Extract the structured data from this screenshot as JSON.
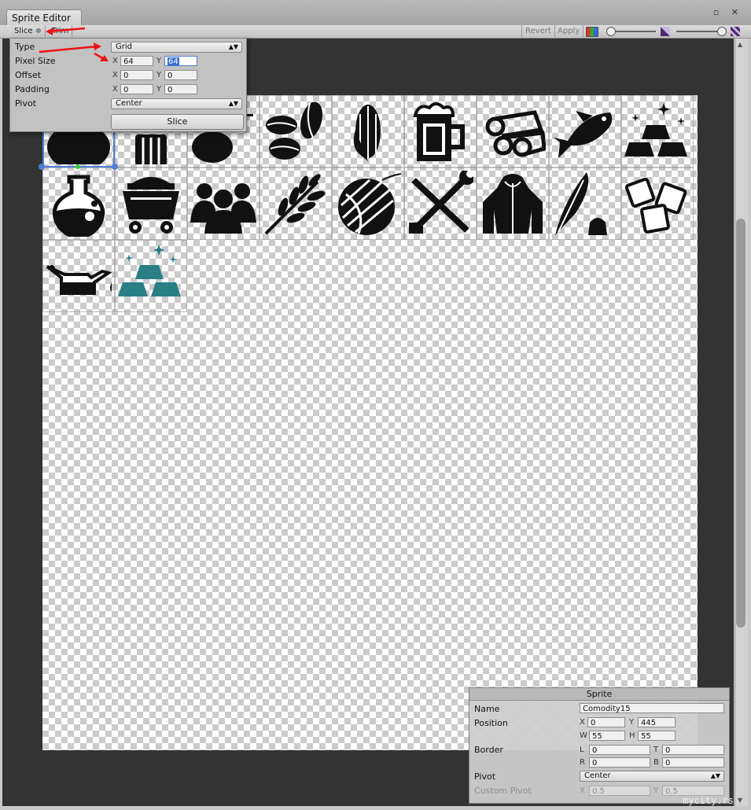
{
  "window": {
    "tab_title": "Sprite Editor",
    "controls": "▫ ✕"
  },
  "toolbar": {
    "slice_label": "Slice ≑",
    "trim_label": "Trim",
    "revert_label": "Revert",
    "apply_label": "Apply"
  },
  "slice_popup": {
    "type_label": "Type",
    "type_value": "Grid",
    "pixel_size_label": "Pixel Size",
    "pixel_x": "64",
    "pixel_y": "64",
    "offset_label": "Offset",
    "offset_x": "0",
    "offset_y": "0",
    "padding_label": "Padding",
    "padding_x": "0",
    "padding_y": "0",
    "pivot_label": "Pivot",
    "pivot_value": "Center",
    "slice_button": "Slice",
    "x_axis": "X",
    "y_axis": "Y"
  },
  "sprite_panel": {
    "title": "Sprite",
    "name_label": "Name",
    "name_value": "Comodity15",
    "position_label": "Position",
    "pos_x": "0",
    "pos_y": "445",
    "pos_w": "55",
    "pos_h": "55",
    "border_label": "Border",
    "border_l": "0",
    "border_t": "0",
    "border_r": "0",
    "border_b": "0",
    "pivot_label": "Pivot",
    "pivot_value": "Center",
    "custom_pivot_label": "Custom Pivot",
    "custom_x": "0.5",
    "custom_y": "0.5",
    "x_axis": "X",
    "y_axis": "Y",
    "w_axis": "W",
    "h_axis": "H",
    "l_axis": "L",
    "t_axis": "T",
    "r_axis": "R",
    "b_axis": "B"
  },
  "sprites": [
    {
      "icon": "oil-bottle-icon"
    },
    {
      "icon": "barrel-icon"
    },
    {
      "icon": "stone-icon"
    },
    {
      "icon": "coffee-beans-icon"
    },
    {
      "icon": "corn-icon"
    },
    {
      "icon": "beer-mug-icon"
    },
    {
      "icon": "logs-icon"
    },
    {
      "icon": "fish-icon"
    },
    {
      "icon": "gold-bars-icon"
    },
    {
      "icon": "potion-flask-icon"
    },
    {
      "icon": "mine-cart-icon"
    },
    {
      "icon": "people-icon"
    },
    {
      "icon": "wheat-icon"
    },
    {
      "icon": "yarn-ball-icon"
    },
    {
      "icon": "tools-icon"
    },
    {
      "icon": "coat-icon"
    },
    {
      "icon": "quill-ink-icon"
    },
    {
      "icon": "ice-cubes-icon"
    },
    {
      "icon": "oil-can-icon"
    },
    {
      "icon": "teal-bars-icon"
    }
  ],
  "colors": {
    "icon": "#111111",
    "teal": "#2a7f86",
    "selection": "#4d7fd6",
    "arrow": "#e11111"
  },
  "watermark": "mycity.rs"
}
